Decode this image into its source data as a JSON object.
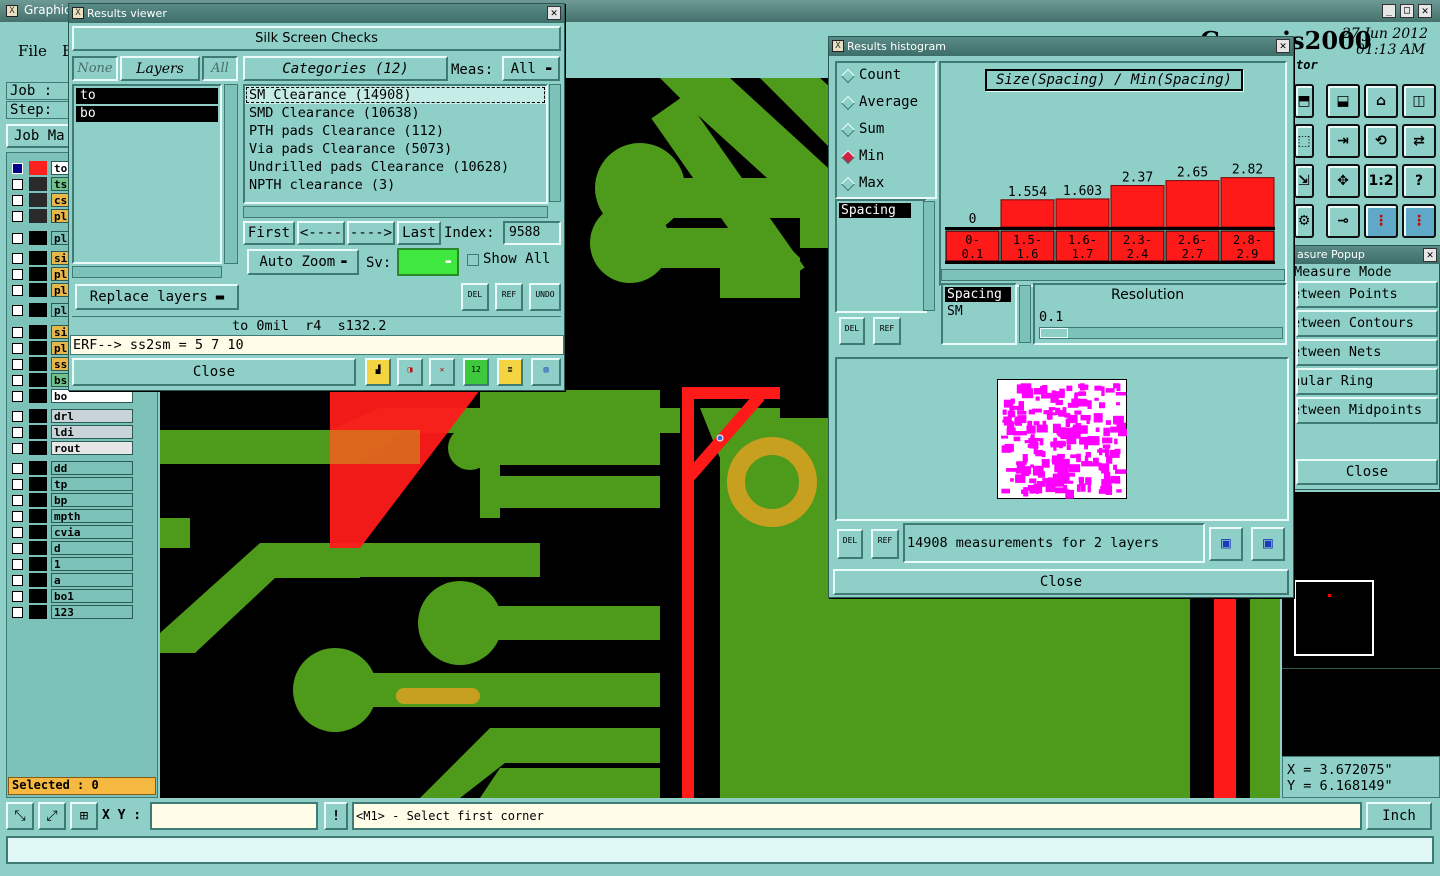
{
  "main": {
    "title": "Graphic",
    "menu_file": "File",
    "menu_edit": "E",
    "job_label": "Job :",
    "step_label": "Step:",
    "job_mgr": "Job Ma",
    "app_name_partial": "Genesis2000",
    "date": "27 Jun 2012",
    "time": "01:13 AM",
    "editor_label": "tor",
    "selected": "Selected : 0",
    "xy_label": "X Y :",
    "status_msg": "<M1> - Select first corner",
    "units": "Inch",
    "coord_x": "X = 3.672075\"",
    "coord_y": "Y = 6.168149\""
  },
  "layers": [
    {
      "name": "to",
      "color": "#ffffff"
    },
    {
      "name": "ts",
      "color": "#6ec28a"
    },
    {
      "name": "cs",
      "color": "#e8b74a"
    },
    {
      "name": "plr",
      "color": "#e8b74a"
    },
    {
      "name": "plr",
      "color": "#7cc2b8"
    },
    {
      "name": "sic",
      "color": "#e8b74a"
    },
    {
      "name": "plr",
      "color": "#e8b74a"
    },
    {
      "name": "plr",
      "color": "#e8b74a"
    },
    {
      "name": "plr",
      "color": "#7cc2b8"
    },
    {
      "name": "sic",
      "color": "#e8b74a"
    },
    {
      "name": "plr",
      "color": "#e8b74a"
    },
    {
      "name": "ss",
      "color": "#e8b74a"
    },
    {
      "name": "bs",
      "color": "#6ec28a"
    },
    {
      "name": "bo",
      "color": "#ffffff"
    },
    {
      "name": "drl",
      "color": "#c8d4d8"
    },
    {
      "name": "ldi",
      "color": "#c8d4d8"
    },
    {
      "name": "rout",
      "color": "#e6e6e6"
    },
    {
      "name": "dd",
      "color": "#7cc2b8"
    },
    {
      "name": "tp",
      "color": "#7cc2b8"
    },
    {
      "name": "bp",
      "color": "#7cc2b8"
    },
    {
      "name": "mpth",
      "color": "#7cc2b8"
    },
    {
      "name": "cvia",
      "color": "#7cc2b8"
    },
    {
      "name": "d",
      "color": "#7cc2b8"
    },
    {
      "name": "1",
      "color": "#7cc2b8"
    },
    {
      "name": "a",
      "color": "#7cc2b8"
    },
    {
      "name": "bo1",
      "color": "#7cc2b8"
    },
    {
      "name": "123",
      "color": "#7cc2b8"
    }
  ],
  "results_viewer": {
    "title": "Results viewer",
    "header": "Silk Screen Checks",
    "none_btn": "None",
    "layers_btn": "Layers",
    "all_btn": "All",
    "layer_list": [
      "to",
      "bo"
    ],
    "categories_btn": "Categories (12)",
    "meas_label": "Meas:",
    "meas_value": "All",
    "categories": [
      "SM Clearance (14908)",
      "SMD Clearance (10638)",
      "PTH pads Clearance (112)",
      "Via pads Clearance (5073)",
      "Undrilled pads Clearance (10628)",
      "NPTH clearance (3)"
    ],
    "first_btn": "First",
    "prev_btn": "<----",
    "next_btn": "---->",
    "last_btn": "Last",
    "index_label": "Index:",
    "index_value": "9588",
    "autozoom": "Auto Zoom",
    "sv_label": "Sv:",
    "show_all": "Show All",
    "replace_layers": "Replace layers",
    "del": "DEL",
    "ref": "REF",
    "undo": "UNDO",
    "info_line": "to 0mil  r4  s132.2",
    "erf_line": "ERF--> ss2sm = 5 7 10",
    "close": "Close"
  },
  "histogram": {
    "title": "Results histogram",
    "modes": [
      "Count",
      "Average",
      "Sum",
      "Min",
      "Max"
    ],
    "selected_mode": "Min",
    "chart_title": "Size(Spacing) / Min(Spacing)",
    "list_item": "Spacing",
    "spacing_label": "Spacing",
    "sm_label": "SM",
    "resolution_label": "Resolution",
    "resolution_value": "0.1",
    "del": "DEL",
    "ref": "REF",
    "summary": "14908 measurements for 2 layers",
    "close": "Close"
  },
  "chart_data": {
    "type": "bar",
    "title": "Size(Spacing) / Min(Spacing)",
    "categories": [
      "0-\n0.1",
      "1.5-\n1.6",
      "1.6-\n1.7",
      "2.3-\n2.4",
      "2.6-\n2.7",
      "2.8-\n2.9"
    ],
    "value_labels": [
      "0",
      "1.554",
      "1.603",
      "2.37",
      "2.65",
      "2.82"
    ],
    "values": [
      0,
      1.554,
      1.603,
      2.37,
      2.65,
      2.82
    ],
    "ylim": [
      0,
      8
    ]
  },
  "measure": {
    "title": "asure Popup",
    "mode_label": "Measure Mode",
    "items": [
      "etween Points",
      "etween Contours",
      "etween Nets",
      "nular Ring",
      "etween Midpoints"
    ],
    "close": "Close"
  },
  "toolbar_icons": [
    "1:2",
    "?"
  ],
  "colors": {
    "copper": "#4e9a1a",
    "board": "#000000",
    "silk": "#ff1a1a",
    "teal": "#8ed0c8",
    "magenta": "#ff00ff"
  }
}
